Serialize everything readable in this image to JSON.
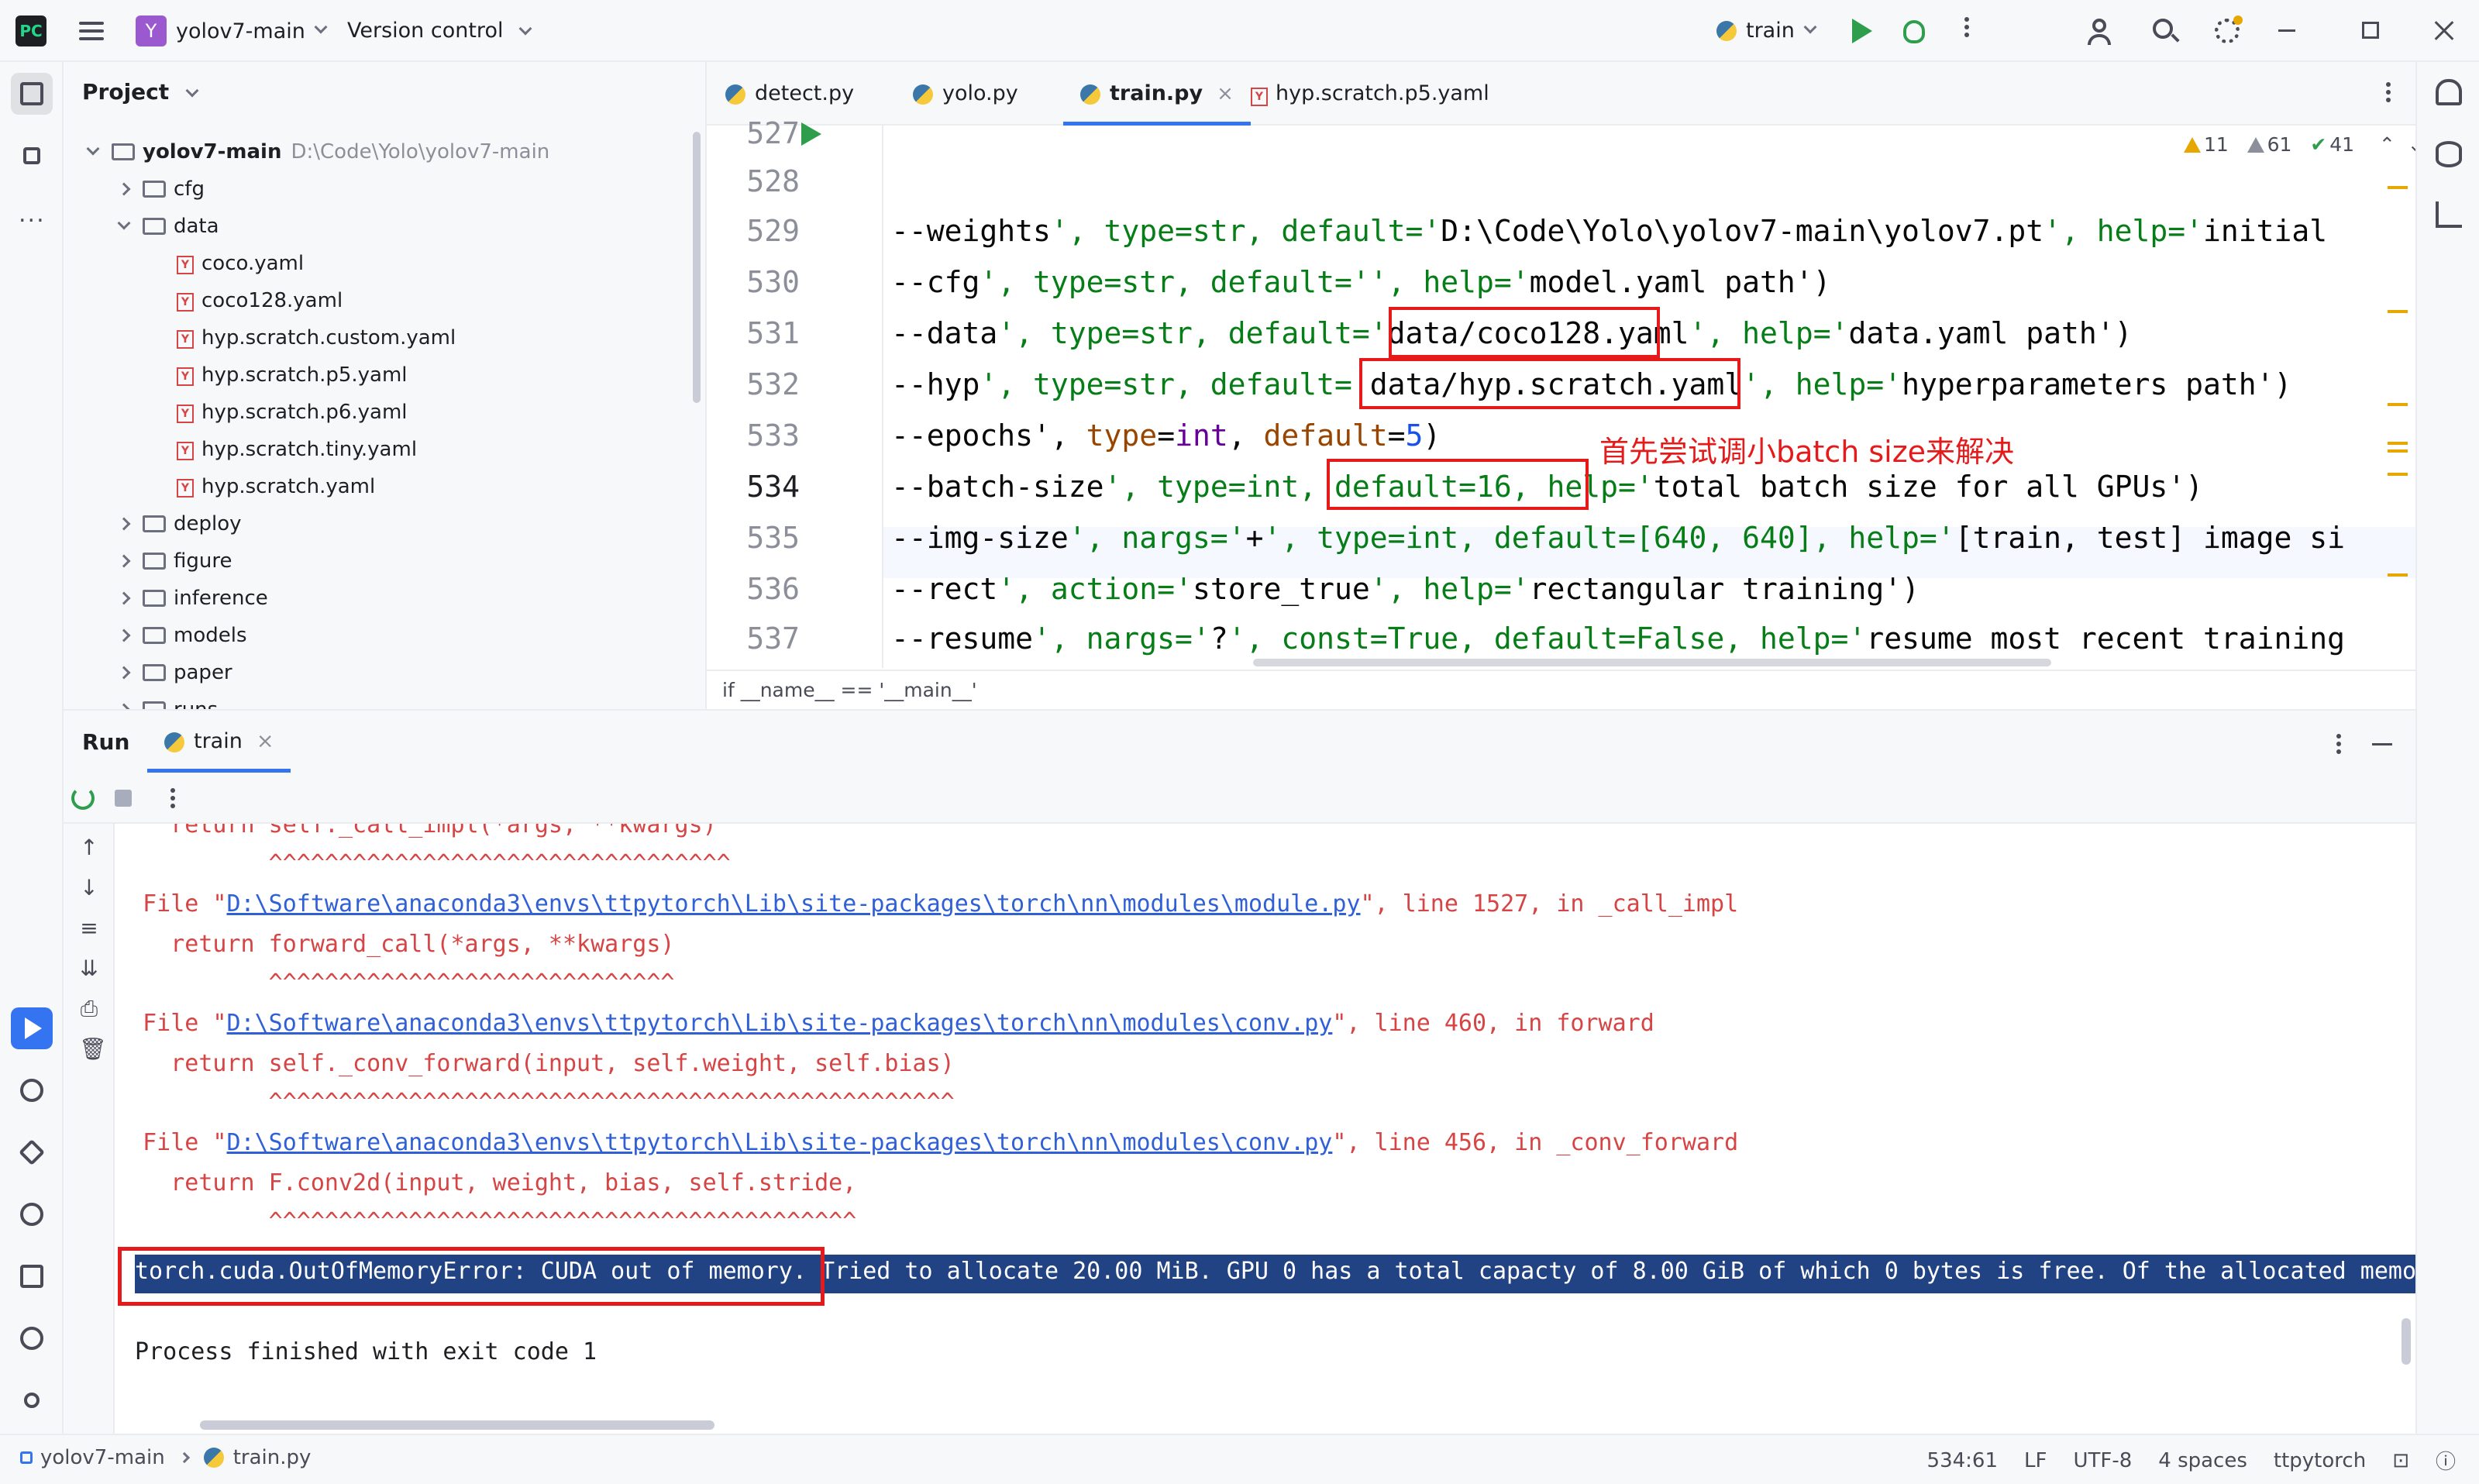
{
  "titlebar": {
    "logo": "PC",
    "project_badge": "Y",
    "project_name": "yolov7-main",
    "vcs_label": "Version control",
    "run_config": "train"
  },
  "project_panel": {
    "title": "Project",
    "root": {
      "name": "yolov7-main",
      "path": "D:\\Code\\Yolo\\yolov7-main"
    },
    "items": [
      {
        "name": "cfg",
        "type": "folder",
        "expanded": false
      },
      {
        "name": "data",
        "type": "folder",
        "expanded": true
      },
      {
        "name": "coco.yaml",
        "type": "yaml"
      },
      {
        "name": "coco128.yaml",
        "type": "yaml"
      },
      {
        "name": "hyp.scratch.custom.yaml",
        "type": "yaml"
      },
      {
        "name": "hyp.scratch.p5.yaml",
        "type": "yaml"
      },
      {
        "name": "hyp.scratch.p6.yaml",
        "type": "yaml"
      },
      {
        "name": "hyp.scratch.tiny.yaml",
        "type": "yaml"
      },
      {
        "name": "hyp.scratch.yaml",
        "type": "yaml"
      },
      {
        "name": "deploy",
        "type": "folder",
        "expanded": false
      },
      {
        "name": "figure",
        "type": "folder",
        "expanded": false
      },
      {
        "name": "inference",
        "type": "folder",
        "expanded": false
      },
      {
        "name": "models",
        "type": "folder",
        "expanded": false
      },
      {
        "name": "paper",
        "type": "folder",
        "expanded": false
      },
      {
        "name": "runs",
        "type": "folder",
        "expanded": false
      }
    ]
  },
  "editor": {
    "tabs": [
      {
        "label": "detect.py",
        "kind": "py",
        "active": false
      },
      {
        "label": "yolo.py",
        "kind": "py",
        "active": false
      },
      {
        "label": "train.py",
        "kind": "py",
        "active": true
      },
      {
        "label": "hyp.scratch.p5.yaml",
        "kind": "yaml",
        "active": false
      }
    ],
    "tab_close": "×",
    "inspections": {
      "warnings": "11",
      "weak_warnings": "61",
      "ok": "41"
    },
    "line_numbers": [
      "527",
      "528",
      "529",
      "530",
      "531",
      "532",
      "533",
      "534",
      "535",
      "536",
      "537"
    ],
    "current_line": "534",
    "lines": [
      "",
      "",
      "--weights', type=str, default='D:\\Code\\Yolo\\yolov7-main\\yolov7.pt', help='initial",
      "--cfg', type=str, default='', help='model.yaml path')",
      "--data', type=str, default='data/coco128.yaml', help='data.yaml path')",
      "--hyp', type=str, default='data/hyp.scratch.yaml', help='hyperparameters path')",
      "--epochs', type=int, default=5)",
      "--batch-size', type=int, default=16, help='total batch size for all GPUs')",
      "--img-size', nargs='+', type=int, default=[640, 640], help='[train, test] image si",
      "--rect', action='store_true', help='rectangular training')",
      "--resume', nargs='?', const=True, default=False, help='resume most recent training"
    ],
    "annotation": "首先尝试调小batch size来解决",
    "breadcrumb": "if __name__ == '__main__'"
  },
  "run_panel": {
    "title": "Run",
    "tab_label": "train",
    "tab_close": "×",
    "console": [
      {
        "text": "    return self._call_impl(*args, **kwargs)",
        "style": "error"
      },
      {
        "text": "           ^^^^^^^^^^^^^^^^^^^^^^^^^^^^^^^^^",
        "style": "error"
      },
      {
        "pre": "  File \"",
        "link": "D:\\Software\\anaconda3\\envs\\ttpytorch\\Lib\\site-packages\\torch\\nn\\modules\\module.py",
        "post": "\", line 1527, in _call_impl",
        "style": "error"
      },
      {
        "text": "    return forward_call(*args, **kwargs)",
        "style": "error"
      },
      {
        "text": "           ^^^^^^^^^^^^^^^^^^^^^^^^^^^^^",
        "style": "error"
      },
      {
        "pre": "  File \"",
        "link": "D:\\Software\\anaconda3\\envs\\ttpytorch\\Lib\\site-packages\\torch\\nn\\modules\\conv.py",
        "post": "\", line 460, in forward",
        "style": "error"
      },
      {
        "text": "    return self._conv_forward(input, self.weight, self.bias)",
        "style": "error"
      },
      {
        "text": "           ^^^^^^^^^^^^^^^^^^^^^^^^^^^^^^^^^^^^^^^^^^^^^^^^^",
        "style": "error"
      },
      {
        "pre": "  File \"",
        "link": "D:\\Software\\anaconda3\\envs\\ttpytorch\\Lib\\site-packages\\torch\\nn\\modules\\conv.py",
        "post": "\", line 456, in _conv_forward",
        "style": "error"
      },
      {
        "text": "    return F.conv2d(input, weight, bias, self.stride,",
        "style": "error"
      },
      {
        "text": "           ^^^^^^^^^^^^^^^^^^^^^^^^^^^^^^^^^^^^^^^^^^",
        "style": "error"
      }
    ],
    "error_line": "torch.cuda.OutOfMemoryError: CUDA out of memory. Tried to allocate 20.00 MiB. GPU 0 has a total capacty of 8.00 GiB of which 0 bytes is free. Of the allocated memor",
    "exit_line": "Process finished with exit code 1"
  },
  "statusbar": {
    "project": "yolov7-main",
    "file": "train.py",
    "position": "534:61",
    "line_sep": "LF",
    "encoding": "UTF-8",
    "indent": "4 spaces",
    "interpreter": "ttpytorch"
  },
  "colors": {
    "accent": "#3574f0",
    "error_text": "#d64545",
    "annotation_red": "#e51a1a",
    "selection": "#214283"
  }
}
